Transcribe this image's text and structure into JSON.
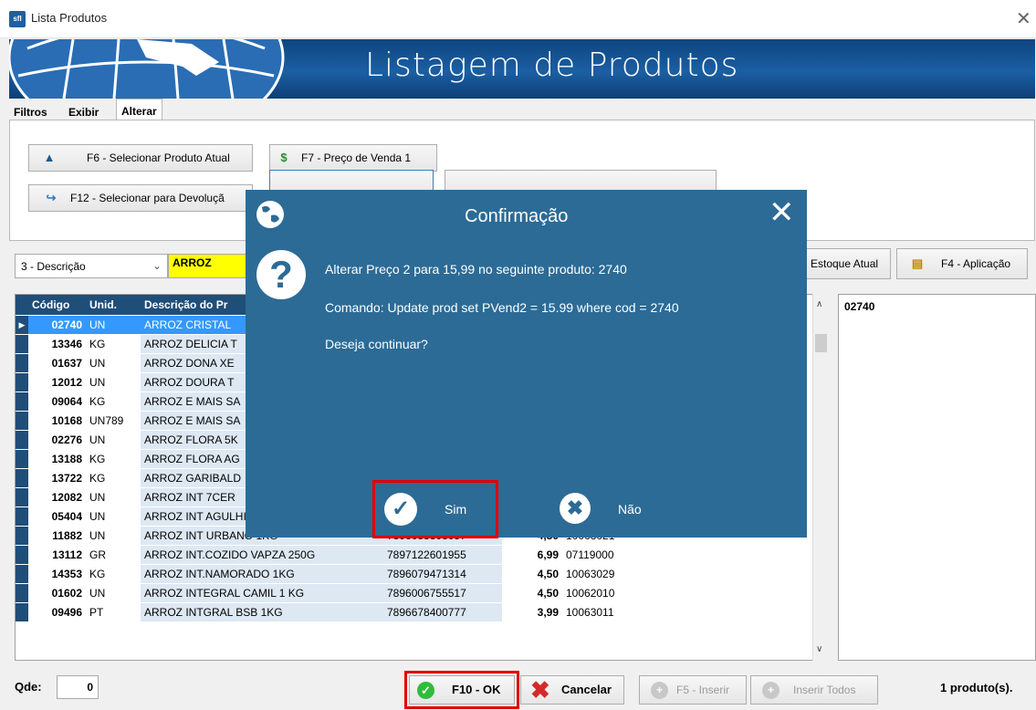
{
  "window": {
    "title": "Lista Produtos",
    "app_icon": "sfl"
  },
  "banner": {
    "title": "Listagem de Produtos"
  },
  "tabs": [
    {
      "label": "Filtros"
    },
    {
      "label": "Exibir"
    },
    {
      "label": "Alterar"
    }
  ],
  "actions": {
    "f6": "F6 - Selecionar Produto Atual",
    "f7": "F7 - Preço de Venda 1",
    "f12": "F12 - Selecionar para Devoluçã"
  },
  "search": {
    "field_option": "3 - Descrição",
    "value": "ARROZ"
  },
  "right_actions": {
    "estoque": "Estoque Atual",
    "f4": "F4 - Aplicação"
  },
  "grid": {
    "columns": [
      "Código",
      "Unid.",
      "Descrição do Pr"
    ],
    "rows": [
      {
        "codigo": "02740",
        "unid": "UN",
        "descricao": "ARROZ CRISTAL",
        "ean": "",
        "preco": "",
        "ncm": ""
      },
      {
        "codigo": "13346",
        "unid": "KG",
        "descricao": "ARROZ DELICIA T",
        "ean": "",
        "preco": "",
        "ncm": ""
      },
      {
        "codigo": "01637",
        "unid": "UN",
        "descricao": "ARROZ DONA XE",
        "ean": "",
        "preco": "",
        "ncm": ""
      },
      {
        "codigo": "12012",
        "unid": "UN",
        "descricao": "ARROZ DOURA T",
        "ean": "",
        "preco": "",
        "ncm": ""
      },
      {
        "codigo": "09064",
        "unid": "KG",
        "descricao": "ARROZ E MAIS SA",
        "ean": "",
        "preco": "",
        "ncm": ""
      },
      {
        "codigo": "10168",
        "unid": "UN789",
        "descricao": "ARROZ E MAIS SA",
        "ean": "",
        "preco": "",
        "ncm": ""
      },
      {
        "codigo": "02276",
        "unid": "UN",
        "descricao": "ARROZ FLORA 5K",
        "ean": "",
        "preco": "",
        "ncm": ""
      },
      {
        "codigo": "13188",
        "unid": "KG",
        "descricao": "ARROZ FLORA AG",
        "ean": "",
        "preco": "",
        "ncm": ""
      },
      {
        "codigo": "13722",
        "unid": "KG",
        "descricao": "ARROZ GARIBALD",
        "ean": "",
        "preco": "",
        "ncm": ""
      },
      {
        "codigo": "12082",
        "unid": "UN",
        "descricao": "ARROZ INT 7CER",
        "ean": "",
        "preco": "",
        "ncm": ""
      },
      {
        "codigo": "05404",
        "unid": "UN",
        "descricao": "ARROZ INT AGULHINHA 1KG",
        "ean": "",
        "preco": "",
        "ncm": ""
      },
      {
        "codigo": "11882",
        "unid": "UN",
        "descricao": "ARROZ INT URBANO 1KG",
        "ean": "7896038308057",
        "preco": "4,50",
        "ncm": "10063021"
      },
      {
        "codigo": "13112",
        "unid": "GR",
        "descricao": "ARROZ INT.COZIDO VAPZA 250G",
        "ean": "7897122601955",
        "preco": "6,99",
        "ncm": "07119000"
      },
      {
        "codigo": "14353",
        "unid": "KG",
        "descricao": "ARROZ INT.NAMORADO 1KG",
        "ean": "7896079471314",
        "preco": "4,50",
        "ncm": "10063029"
      },
      {
        "codigo": "01602",
        "unid": "UN",
        "descricao": "ARROZ INTEGRAL CAMIL 1 KG",
        "ean": "7896006755517",
        "preco": "4,50",
        "ncm": "10062010"
      },
      {
        "codigo": "09496",
        "unid": "PT",
        "descricao": "ARROZ INTGRAL BSB 1KG",
        "ean": "7896678400777",
        "preco": "3,99",
        "ncm": "10063011"
      }
    ]
  },
  "side_panel": {
    "code": "02740"
  },
  "footer": {
    "qde_label": "Qde:",
    "qde_value": "0",
    "ok": "F10 - OK",
    "cancel": "Cancelar",
    "f5": "F5 - Inserir",
    "insert_all": "Inserir Todos",
    "count": "1 produto(s)."
  },
  "dialog": {
    "title": "Confirmação",
    "line1": "Alterar Preço 2 para 15,99 no seguinte produto: 2740",
    "line2": "Comando: Update prod set PVend2 = 15.99 where cod = 2740",
    "line3": "Deseja continuar?",
    "yes": "Sim",
    "no": "Não"
  },
  "colors": {
    "dialog_bg": "#2c6b96",
    "grid_header": "#1f4e79",
    "selection": "#3399ff",
    "search_highlight": "#ffff00",
    "annotation_red": "#e00000",
    "ok_green": "#2ebd3a",
    "cancel_red": "#d42a2a"
  }
}
